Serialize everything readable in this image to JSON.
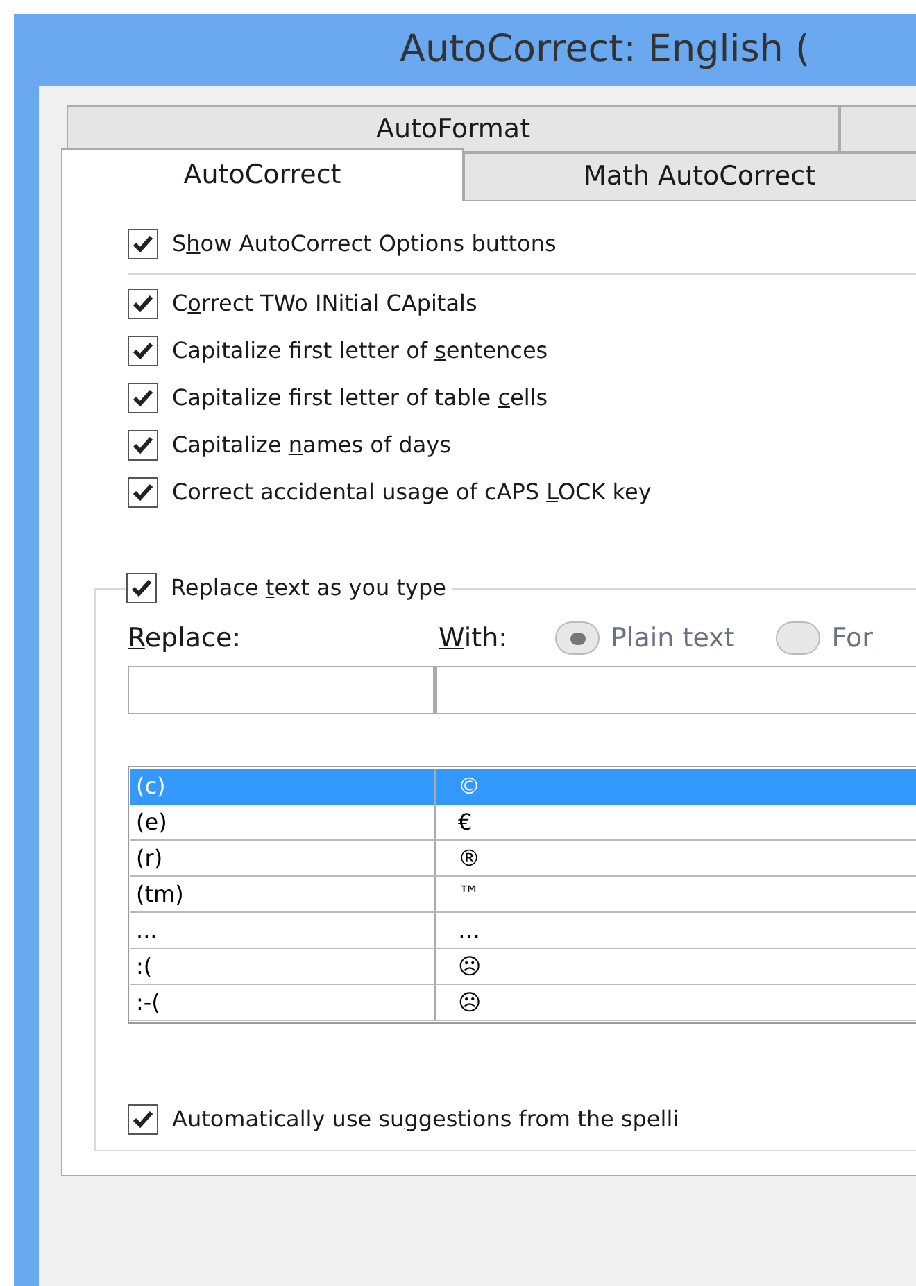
{
  "window": {
    "title": "AutoCorrect: English ("
  },
  "tab_rows": [
    [
      {
        "label": "AutoFormat",
        "selected": false
      }
    ],
    [
      {
        "label": "AutoCorrect",
        "selected": true
      },
      {
        "label": "Math AutoCorrect",
        "selected": false
      }
    ]
  ],
  "options": [
    {
      "label": [
        "S",
        "h",
        "ow AutoCorrect Options buttons"
      ],
      "checked": true
    },
    {
      "label": [
        "C",
        "o",
        "rrect TWo INitial CApitals"
      ],
      "checked": true
    },
    {
      "label": [
        "Capitalize first letter of ",
        "s",
        "entences"
      ],
      "checked": true
    },
    {
      "label": [
        "Capitalize first letter of table ",
        "c",
        "ells"
      ],
      "checked": true
    },
    {
      "label": [
        "Capitalize ",
        "n",
        "ames of days"
      ],
      "checked": true
    },
    {
      "label": [
        "Correct accidental usage of cAPS ",
        "L",
        "OCK key"
      ],
      "checked": true
    }
  ],
  "replace_group": {
    "header": {
      "label": [
        "Replace ",
        "t",
        "ext as you type"
      ],
      "checked": true
    },
    "replace_label": [
      "R",
      "eplace:"
    ],
    "with_label": [
      "W",
      "ith:"
    ],
    "format_options": [
      {
        "label": "Plain text",
        "selected": true,
        "disabled": true
      },
      {
        "label": "For",
        "selected": false,
        "disabled": true
      }
    ],
    "rows": [
      {
        "cells": [
          "(c)",
          "©"
        ],
        "selected": true
      },
      {
        "cells": [
          "(e)",
          "€"
        ],
        "selected": false
      },
      {
        "cells": [
          "(r)",
          "®"
        ],
        "selected": false
      },
      {
        "cells": [
          "(tm)",
          "™"
        ],
        "selected": false
      },
      {
        "cells": [
          "...",
          "…"
        ],
        "selected": false
      },
      {
        "cells": [
          ":(",
          "☹"
        ],
        "selected": false
      },
      {
        "cells": [
          ":-(",
          "☹"
        ],
        "selected": false
      }
    ],
    "footer": {
      "label": [
        "Automatically use su",
        "g",
        "gestions from the spelli"
      ],
      "checked": true
    }
  }
}
